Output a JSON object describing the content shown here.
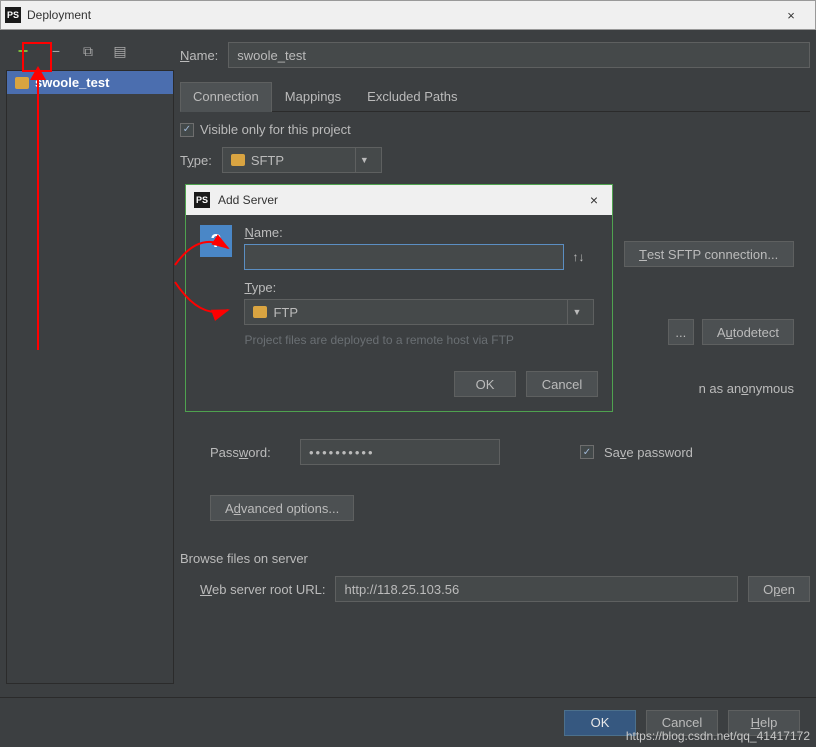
{
  "window": {
    "title": "Deployment",
    "close": "×"
  },
  "toolbar": {
    "add": "+",
    "remove": "−"
  },
  "sidebar": {
    "server": "swoole_test"
  },
  "main": {
    "name_label": "Name:",
    "name_value": "swoole_test",
    "tabs": {
      "connection": "Connection",
      "mappings": "Mappings",
      "excluded": "Excluded Paths"
    },
    "visible_label": "Visible only for this project",
    "type_label": "Type:",
    "type_value": "SFTP",
    "test_btn": "Test SFTP connection...",
    "autodetect": "Autodetect",
    "ellipsis": "...",
    "anonymous": "n as anonymous",
    "password_label": "Password:",
    "password_value": "••••••••••",
    "save_password": "Save password",
    "advanced": "Advanced options...",
    "browse_label": "Browse files on server",
    "weburl_label": "Web server root URL:",
    "weburl_value": "http://118.25.103.56",
    "open": "Open"
  },
  "modal": {
    "title": "Add Server",
    "close": "×",
    "name_label": "Name:",
    "name_value": "",
    "sort": "↑↓",
    "type_label": "Type:",
    "type_value": "FTP",
    "hint": "Project files are deployed to a remote host via FTP",
    "ok": "OK",
    "cancel": "Cancel"
  },
  "footer": {
    "ok": "OK",
    "cancel": "Cancel",
    "help": "Help"
  },
  "watermark": "https://blog.csdn.net/qq_41417172"
}
